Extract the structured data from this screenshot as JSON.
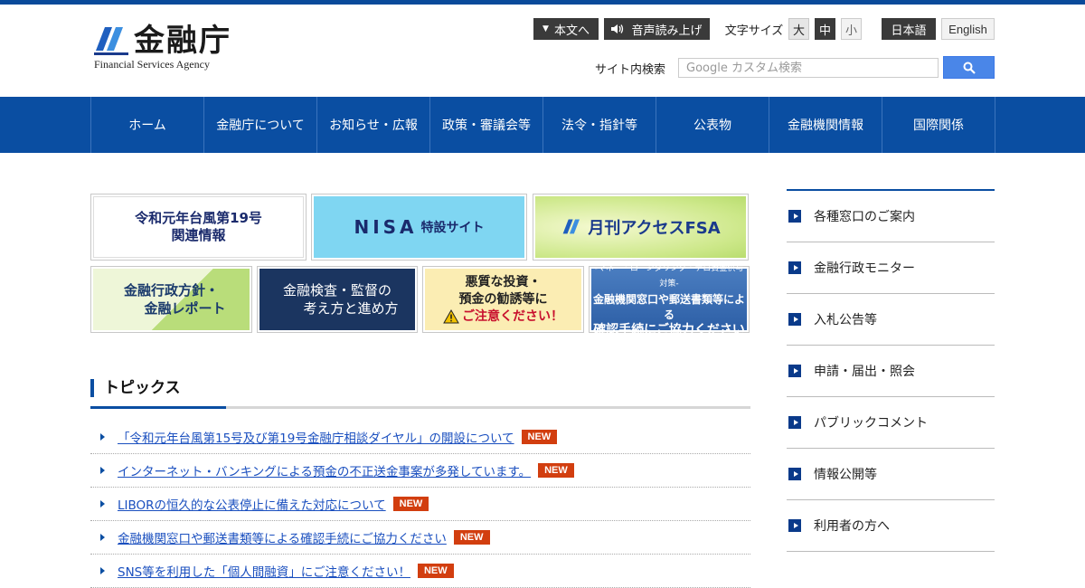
{
  "logo": {
    "title": "金融庁",
    "subtitle": "Financial Services Agency"
  },
  "utility": {
    "skip_label": "本文へ",
    "voice_label": "音声読み上げ",
    "font_size_label": "文字サイズ",
    "font_sizes": [
      "大",
      "中",
      "小"
    ],
    "font_size_selected": "中",
    "lang_ja": "日本語",
    "lang_en": "English"
  },
  "search": {
    "label": "サイト内検索",
    "placeholder": "Google カスタム検索"
  },
  "nav": [
    "ホーム",
    "金融庁について",
    "お知らせ・広報",
    "政策・審議会等",
    "法令・指針等",
    "公表物",
    "金融機関情報",
    "国際関係"
  ],
  "banners": {
    "typhoon": [
      "令和元年台風第19号",
      "関連情報"
    ],
    "nisa": {
      "main": "NISA",
      "sub": "特設サイト"
    },
    "access": "月刊アクセスFSA",
    "policy": [
      "金融行政方針・",
      "金融レポート"
    ],
    "inspection": [
      "金融検査・監督の",
      "考え方と進め方"
    ],
    "warning": [
      "悪質な投資・",
      "預金の勧誘等に",
      "ご注意ください！"
    ],
    "aml": [
      "-マネー・ローンダリング・テロ資金供与対策-",
      "金融機関窓口や郵送書類等による",
      "確認手続にご協力ください"
    ]
  },
  "topics": {
    "heading": "トピックス",
    "badge": "NEW",
    "items": [
      "「令和元年台風第15号及び第19号金融庁相談ダイヤル」の開設について",
      "インターネット・バンキングによる預金の不正送金事案が多発しています。",
      "LIBORの恒久的な公表停止に備えた対応について",
      "金融機関窓口や郵送書類等による確認手続にご協力ください",
      "SNS等を利用した「個人間融資」にご注意ください！"
    ]
  },
  "side_menu": [
    "各種窓口のご案内",
    "金融行政モニター",
    "入札公告等",
    "申請・届出・照会",
    "パブリックコメント",
    "情報公開等",
    "利用者の方へ"
  ],
  "colors": {
    "brand": "#0a4ea2",
    "badge": "#d23e0f",
    "link": "#1a4fbf"
  }
}
